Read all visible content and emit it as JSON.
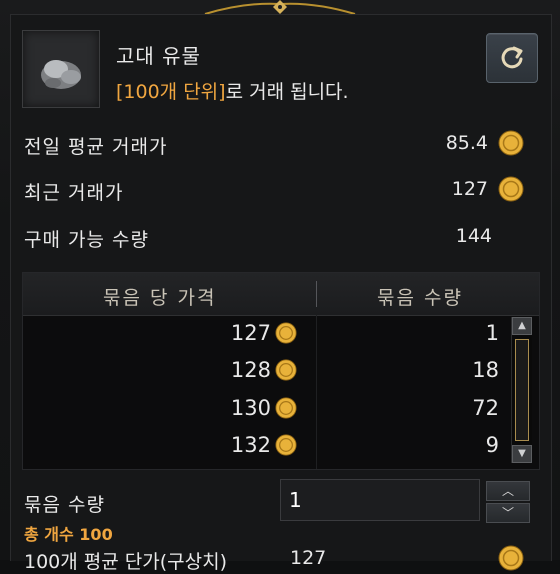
{
  "item": {
    "name": "고대 유물",
    "trade_unit_highlight": "[100개 단위]",
    "trade_unit_rest": "로 거래 됩니다."
  },
  "stats": {
    "prev_avg_label": "전일 평균 거래가",
    "prev_avg_value": "85.4",
    "recent_label": "최근 거래가",
    "recent_value": "127",
    "buyable_label": "구매 가능 수량",
    "buyable_value": "144"
  },
  "table": {
    "col_price": "묶음 당 가격",
    "col_qty": "묶음 수량",
    "rows": [
      {
        "price": "127",
        "qty": "1"
      },
      {
        "price": "128",
        "qty": "18"
      },
      {
        "price": "130",
        "qty": "72"
      },
      {
        "price": "132",
        "qty": "9"
      }
    ]
  },
  "purchase": {
    "bundle_label": "묶음 수량",
    "bundle_value": "1",
    "total_count": "총 개수 100",
    "avg_label": "100개 평균 단가(구상치)",
    "avg_value": "127"
  },
  "icons": {
    "coin": "gold-coin-icon",
    "refresh": "refresh-icon",
    "up": "chevron-up-icon",
    "down": "chevron-down-icon"
  },
  "colors": {
    "accent": "#f0a640",
    "coin": "#e8b23a"
  }
}
